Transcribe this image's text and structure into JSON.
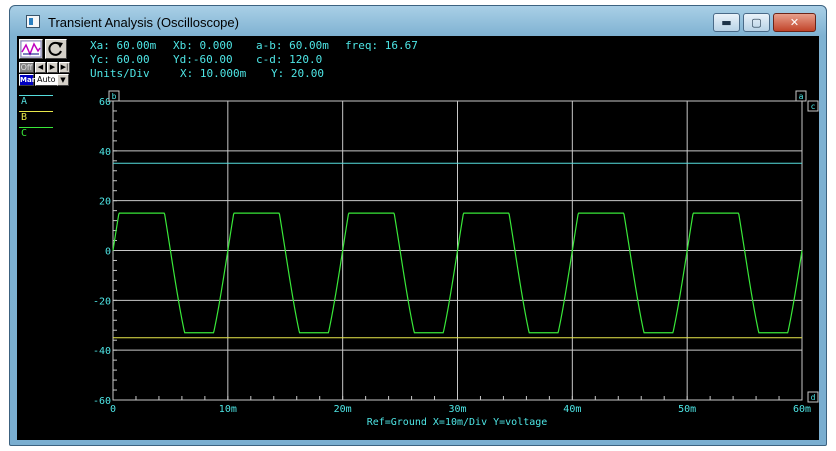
{
  "window": {
    "title": "Transient Analysis (Oscilloscope)",
    "controls": {
      "minimize": "▬",
      "maximize": "▢",
      "close": "✕"
    }
  },
  "toolbar": {
    "off_label": "Off",
    "man_label": "Man",
    "auto_label": "Auto"
  },
  "readouts": {
    "xa": "Xa: 60.00m",
    "xb": "Xb: 0.000",
    "ab": "a-b: 60.00m",
    "freq": "freq: 16.67",
    "yc": "Yc: 60.00",
    "yd": "Yd:-60.00",
    "cd": "c-d: 120.0",
    "units_label": "Units/Div",
    "x_units": "X: 10.000m",
    "y_units": "Y: 20.00"
  },
  "legend": [
    {
      "name": "A",
      "color": "#55dddd"
    },
    {
      "name": "B",
      "color": "#e8e84a"
    },
    {
      "name": "C",
      "color": "#39e839"
    }
  ],
  "cursors": {
    "a": "a",
    "b": "b",
    "c": "c",
    "d": "d"
  },
  "colors": {
    "grid": "#c8c8c8",
    "axis_text": "#4ee6e6",
    "background": "#000000"
  },
  "chart_data": {
    "type": "line",
    "x_range": [
      0,
      60
    ],
    "x_unit": "ms",
    "ylim": [
      -60,
      60
    ],
    "x_ticks": [
      "0",
      "10m",
      "20m",
      "30m",
      "40m",
      "50m",
      "60m"
    ],
    "y_ticks": [
      "60",
      "40",
      "20",
      "0",
      "-20",
      "-40",
      "-60"
    ],
    "grid": true,
    "footer": "Ref=Ground  X=10m/Div Y=voltage",
    "series": [
      {
        "name": "A",
        "color": "#55dddd",
        "kind": "constant",
        "value": 35
      },
      {
        "name": "B",
        "color": "#e8e84a",
        "kind": "constant",
        "value": -35
      },
      {
        "name": "C",
        "color": "#39e839",
        "kind": "clipped-sine",
        "period_ms": 10,
        "amplitude": 47,
        "offset": 0,
        "clip_high": 15,
        "clip_low": -33
      }
    ]
  }
}
